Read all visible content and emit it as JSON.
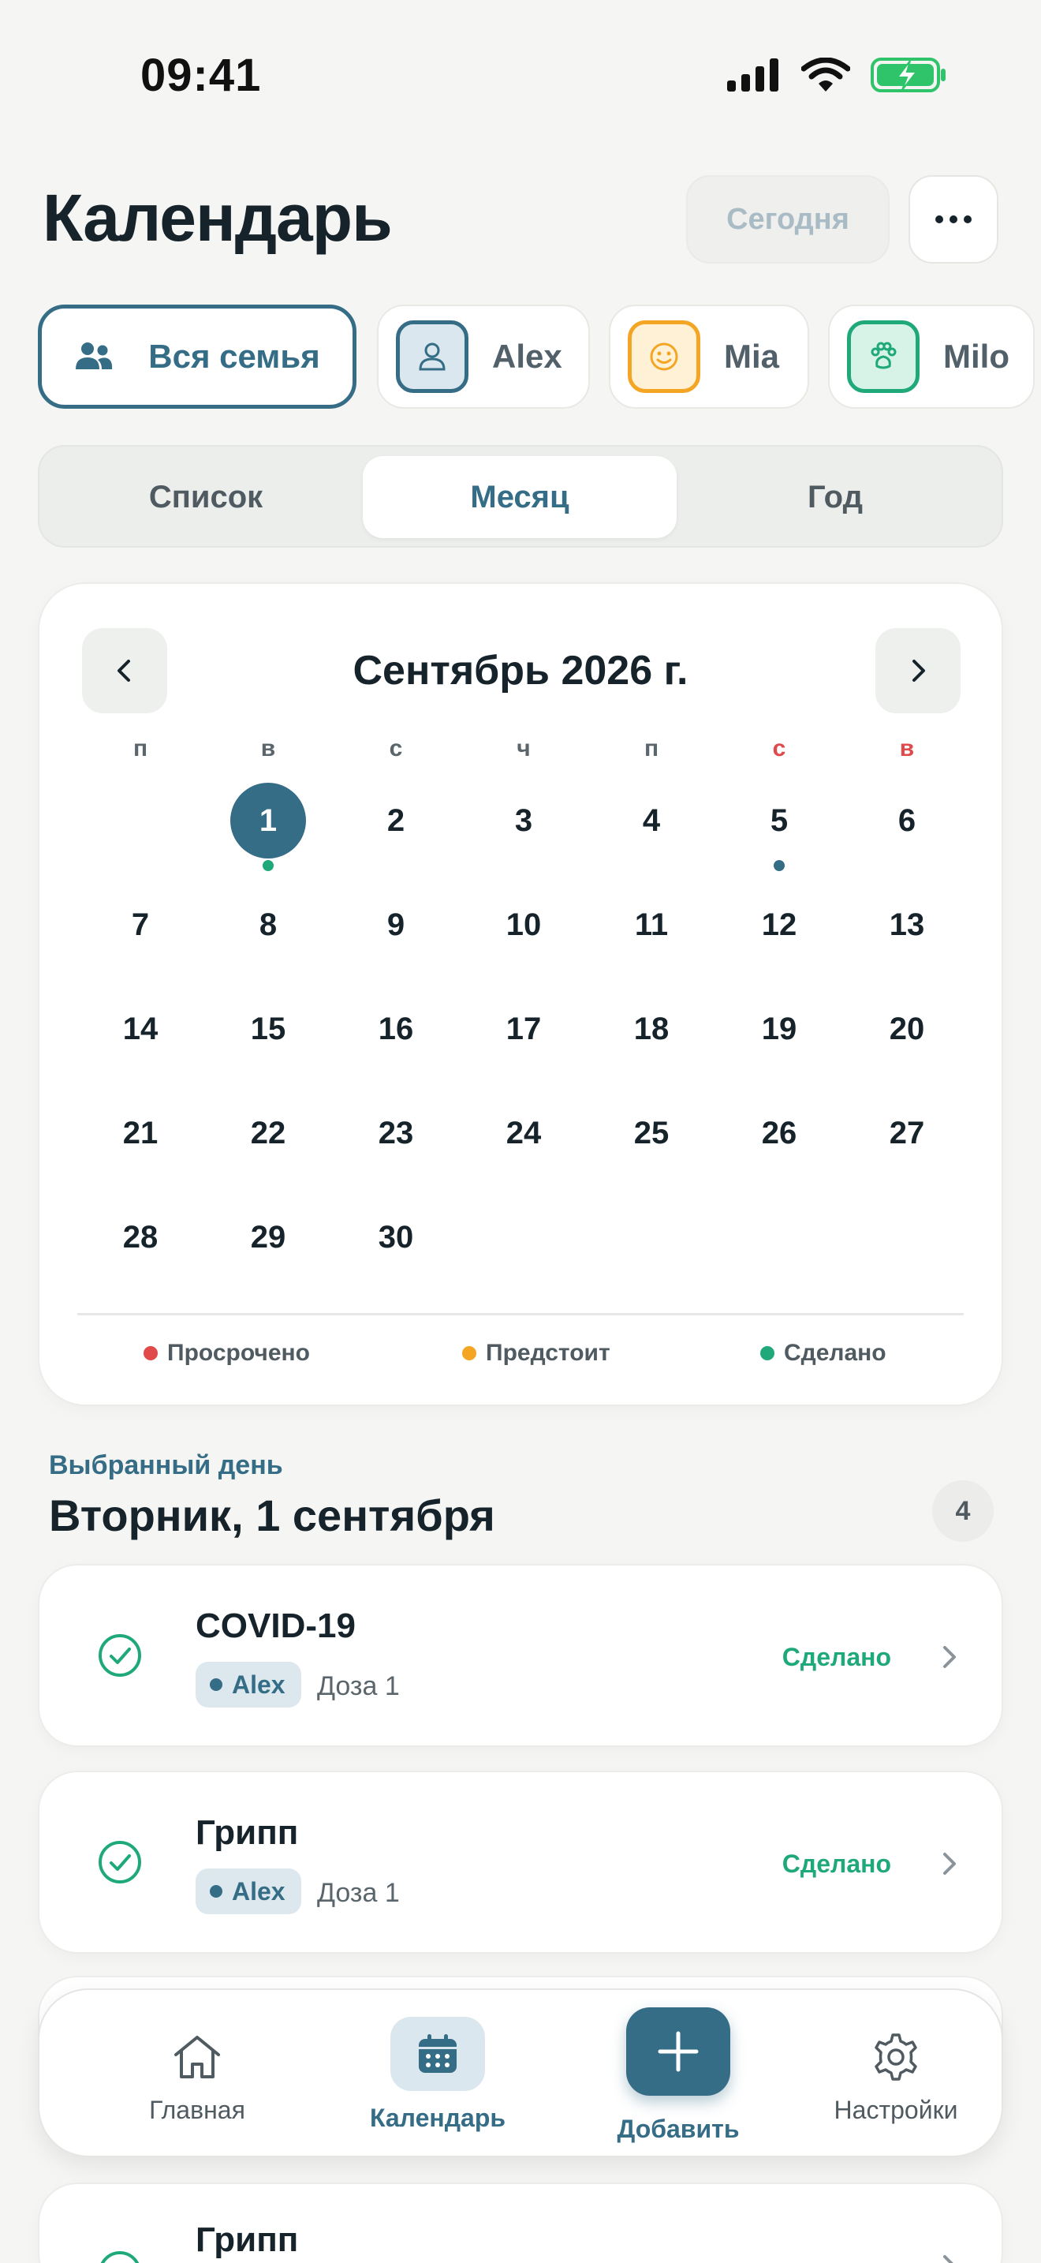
{
  "status_bar": {
    "time": "09:41"
  },
  "header": {
    "title": "Календарь",
    "today_label": "Сегодня"
  },
  "filters": {
    "all": "Вся семья",
    "members": [
      {
        "name": "Alex",
        "icon": "person-icon",
        "color": "#356c86"
      },
      {
        "name": "Mia",
        "icon": "smiley-icon",
        "color": "#f5a524"
      },
      {
        "name": "Milo",
        "icon": "paw-icon",
        "color": "#1fa97b"
      }
    ]
  },
  "view_tabs": {
    "list": "Список",
    "month": "Месяц",
    "year": "Год",
    "selected": "Месяц"
  },
  "calendar": {
    "title": "Сентябрь 2026 г.",
    "weekdays": [
      "п",
      "в",
      "с",
      "ч",
      "п",
      "с",
      "в"
    ],
    "days": [
      "1",
      "2",
      "3",
      "4",
      "5",
      "6",
      "7",
      "8",
      "9",
      "10",
      "11",
      "12",
      "13",
      "14",
      "15",
      "16",
      "17",
      "18",
      "19",
      "20",
      "21",
      "22",
      "23",
      "24",
      "25",
      "26",
      "27",
      "28",
      "29",
      "30"
    ],
    "selected_day": "1",
    "legend": {
      "overdue": "Просрочено",
      "upcoming": "Предстоит",
      "done": "Сделано"
    },
    "colors": {
      "overdue": "#e04a4a",
      "upcoming": "#f5a524",
      "done": "#1fa97b",
      "accent": "#356c86"
    }
  },
  "selected_day": {
    "caption": "Выбранный день",
    "date": "Вторник, 1 сентября",
    "count": "4",
    "events": [
      {
        "title": "COVID-19",
        "member": "Alex",
        "dose": "Доза 1",
        "status": "Сделано"
      },
      {
        "title": "Грипп",
        "member": "Alex",
        "dose": "Доза 1",
        "status": "Сделано"
      },
      {
        "title": "Грипп"
      }
    ]
  },
  "bottom_nav": {
    "home": "Главная",
    "calendar": "Календарь",
    "add": "Добавить",
    "settings": "Настройки"
  }
}
